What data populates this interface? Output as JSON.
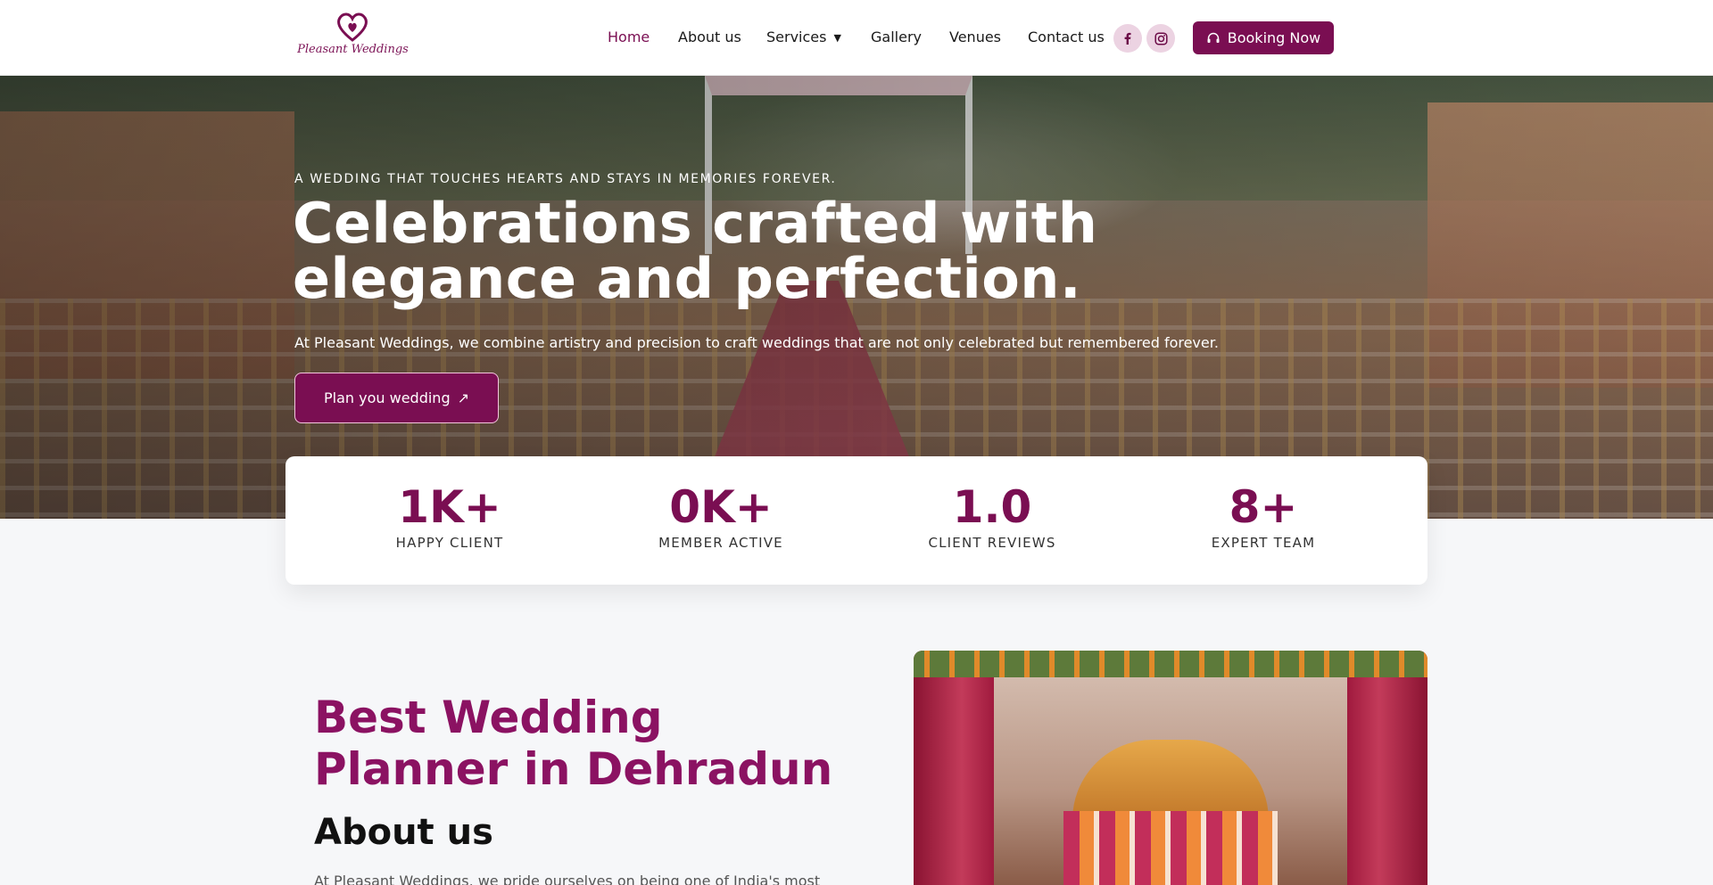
{
  "brand": {
    "name": "Pleasant Weddings"
  },
  "nav": {
    "items": [
      {
        "label": "Home"
      },
      {
        "label": "About us"
      },
      {
        "label": "Services"
      },
      {
        "label": "Gallery"
      },
      {
        "label": "Venues"
      },
      {
        "label": "Contact us"
      }
    ],
    "active": "Home",
    "booking_label": "Booking Now"
  },
  "social": {
    "facebook": "facebook-icon",
    "instagram": "instagram-icon"
  },
  "hero": {
    "tagline": "A WEDDING THAT TOUCHES HEARTS AND STAYS IN MEMORIES FOREVER.",
    "title": "Celebrations crafted with elegance and perfection.",
    "subtitle": "At Pleasant Weddings, we combine artistry and precision to craft weddings that are not only celebrated but remembered forever.",
    "cta_label": "Plan you wedding"
  },
  "stats": [
    {
      "value": "1K+",
      "label": "HAPPY CLIENT"
    },
    {
      "value": "0K+",
      "label": "MEMBER ACTIVE"
    },
    {
      "value": "1.0",
      "label": "CLIENT REVIEWS"
    },
    {
      "value": "8+",
      "label": "EXPERT TEAM"
    }
  ],
  "about": {
    "heading": "Best Wedding Planner in Dehradun",
    "title": "About us",
    "paragraph": "At Pleasant Weddings, we pride ourselves on being one of India's most"
  },
  "colors": {
    "brand": "#7a0e52",
    "accent": "#8b1262",
    "social_bg": "#ecd3e2"
  }
}
